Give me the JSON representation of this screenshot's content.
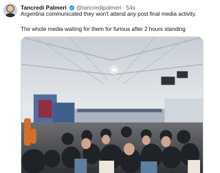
{
  "tweet": {
    "author": {
      "display_name": "Tancredi Palmeri",
      "handle": "@tancredipalmeri",
      "separator": "·",
      "timestamp": "54s",
      "verified_icon": "verified-badge-icon",
      "verified_color": "#1d9bf0"
    },
    "text_lines": [
      "Argentina communicated they won't attend any post final media activity.",
      "The whole media waiting for them for furious after 2 hours standing"
    ],
    "media": {
      "type": "photo"
    }
  }
}
